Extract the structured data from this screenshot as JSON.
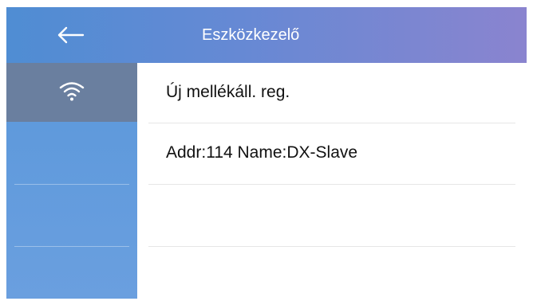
{
  "header": {
    "title": "Eszközkezelő",
    "back_icon": "arrow-left-icon"
  },
  "sidebar": {
    "items": [
      {
        "icon": "wifi-icon",
        "active": true
      },
      {
        "icon": "",
        "active": false
      },
      {
        "icon": "",
        "active": false
      },
      {
        "icon": "",
        "active": false
      }
    ]
  },
  "main": {
    "items": [
      {
        "label": "Új mellékáll. reg."
      },
      {
        "label": "Addr:114 Name:DX-Slave"
      },
      {
        "label": ""
      },
      {
        "label": ""
      }
    ]
  },
  "colors": {
    "header_gradient_start": "#4f8dd3",
    "header_gradient_end": "#8a84cf",
    "sidebar": "#5b98db",
    "sidebar_active": "#6a7f9f",
    "text": "#111111"
  }
}
